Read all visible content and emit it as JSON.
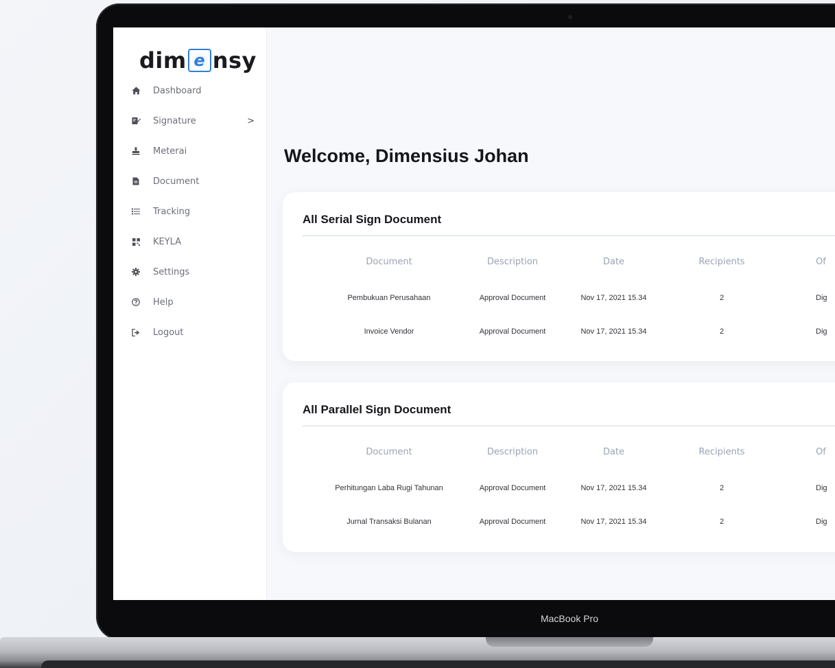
{
  "sidebar": {
    "logo": {
      "prefix": "dim",
      "mark": "e",
      "suffix": "nsy"
    },
    "items": [
      {
        "label": "Dashboard",
        "icon": "home-icon"
      },
      {
        "label": "Signature",
        "icon": "signature-icon",
        "has_submenu": true
      },
      {
        "label": "Meterai",
        "icon": "stamp-icon"
      },
      {
        "label": "Document",
        "icon": "file-icon"
      },
      {
        "label": "Tracking",
        "icon": "list-icon"
      },
      {
        "label": "KEYLA",
        "icon": "qr-icon"
      },
      {
        "label": "Settings",
        "icon": "gear-icon"
      },
      {
        "label": "Help",
        "icon": "help-icon"
      },
      {
        "label": "Logout",
        "icon": "logout-icon"
      }
    ],
    "submenu_chevron": ">"
  },
  "main": {
    "welcome": "Welcome, Dimensius Johan",
    "columns": [
      "Document",
      "Description",
      "Date",
      "Recipients",
      "Of"
    ],
    "serial": {
      "title": "All Serial Sign Document",
      "rows": [
        [
          "Pembukuan Perusahaan",
          "Approval Document",
          "Nov 17, 2021 15.34",
          "2",
          "Dig"
        ],
        [
          "Invoice Vendor",
          "Approval Document",
          "Nov 17, 2021 15.34",
          "2",
          "Dig"
        ]
      ]
    },
    "parallel": {
      "title": "All Parallel Sign Document",
      "rows": [
        [
          "Perhitungan Laba Rugi Tahunan",
          "Approval Document",
          "Nov 17, 2021 15.34",
          "2",
          "Dig"
        ],
        [
          "Jurnal Transaksi Bulanan",
          "Approval Document",
          "Nov 17, 2021 15.34",
          "2",
          "Dig"
        ]
      ]
    }
  },
  "device": {
    "label": "MacBook Pro"
  },
  "colors": {
    "accent": "#2f7fd6",
    "header_text": "#9aa3b6",
    "background": "#f7f8fc"
  }
}
